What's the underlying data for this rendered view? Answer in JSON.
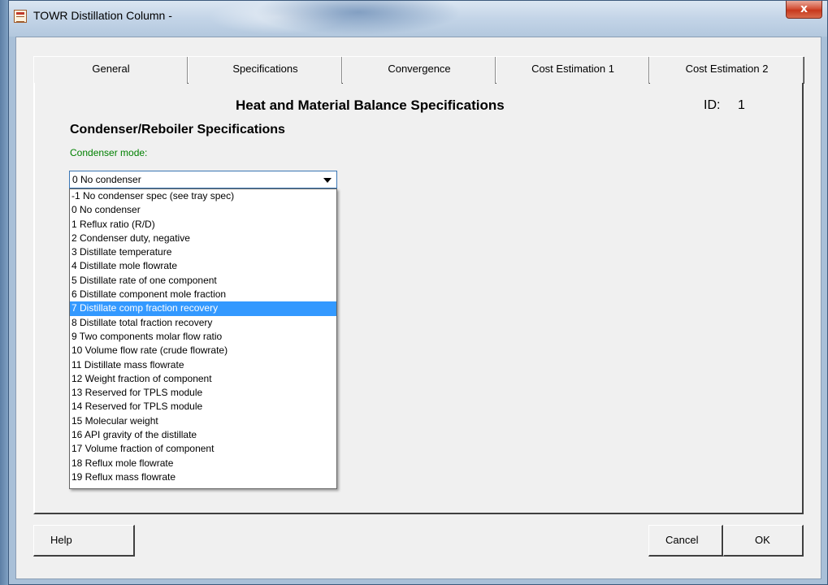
{
  "window": {
    "title": "TOWR Distillation Column -",
    "close_glyph": "x"
  },
  "tabs": [
    {
      "label": "General"
    },
    {
      "label": "Specifications"
    },
    {
      "label": "Convergence"
    },
    {
      "label": "Cost Estimation 1"
    },
    {
      "label": "Cost Estimation 2"
    }
  ],
  "panel": {
    "title": "Heat and Material Balance Specifications",
    "id_label": "ID:",
    "id_value": "1"
  },
  "section": {
    "title": "Condenser/Reboiler Specifications",
    "mode_label": "Condenser mode:"
  },
  "combo": {
    "selected": "0 No condenser",
    "highlighted_index": 8,
    "options": [
      "-1 No condenser spec (see tray spec)",
      "0 No condenser",
      "1 Reflux ratio (R/D)",
      "2 Condenser duty, negative",
      "3 Distillate temperature",
      "4 Distillate mole flowrate",
      "5 Distillate rate of one component",
      "6 Distillate component mole fraction",
      "7 Distillate comp fraction recovery",
      "8 Distillate total fraction recovery",
      "9 Two components molar flow ratio",
      "10 Volume flow rate (crude flowrate)",
      "11 Distillate mass flowrate",
      "12 Weight fraction of component",
      "13 Reserved for TPLS module",
      "14 Reserved for TPLS module",
      "15 Molecular weight",
      "16 API gravity of the distillate",
      "17 Volume fraction of component",
      "18 Reflux mole flowrate",
      "19 Reflux mass flowrate"
    ]
  },
  "buttons": {
    "help": "Help",
    "cancel": "Cancel",
    "ok": "OK"
  },
  "colors": {
    "label_green": "#008000",
    "selection_blue": "#3399ff"
  }
}
